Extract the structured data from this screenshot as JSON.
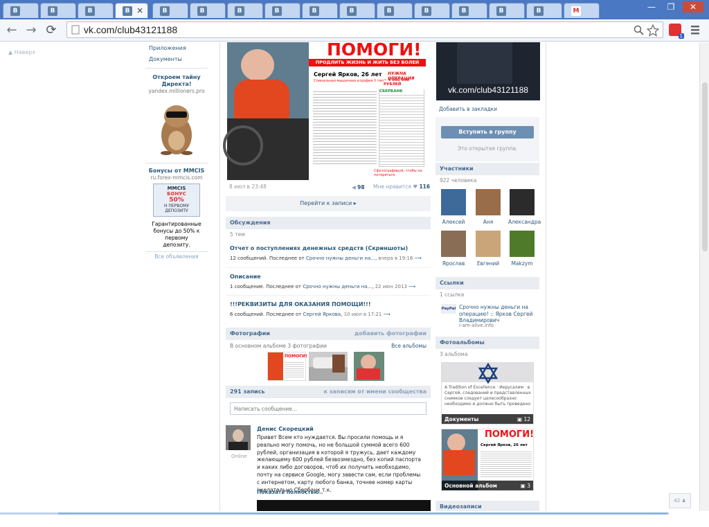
{
  "browser": {
    "tabs": [
      {
        "active": false
      },
      {
        "active": false
      },
      {
        "active": false
      },
      {
        "active": true,
        "close": "×"
      },
      {
        "active": false
      },
      {
        "active": false
      },
      {
        "active": false
      },
      {
        "active": false
      },
      {
        "active": false
      },
      {
        "active": false
      },
      {
        "active": false
      },
      {
        "active": false
      },
      {
        "active": false
      },
      {
        "active": false
      },
      {
        "active": false
      },
      {
        "active": false
      }
    ],
    "url": "vk.com/club43121188",
    "window_buttons": [
      "—",
      "❐",
      "✕"
    ],
    "nav": {
      "back": "←",
      "forward": "→",
      "reload": "⟳"
    },
    "extension_badge": "1"
  },
  "sidebar": {
    "nav_hint": "▲ Наверх",
    "menu": [
      {
        "label": "Приложения"
      },
      {
        "label": "Документы"
      }
    ],
    "ads": [
      {
        "title": "Откроем тайну Директа!",
        "domain": "yandex.millioners.pro"
      },
      {
        "title": "Бонусы от MMCIS",
        "domain": "ru.forex-mmcis.com",
        "banner": "MMCIS",
        "banner_line1": "БОНУС",
        "banner_line2": "50%",
        "banner_line3": "Н ПЕРВОМУ",
        "banner_line4": "ДЕПОЗИТУ",
        "desc": "Гарантированные бонусы до 50% к первому депозиту."
      }
    ],
    "all_ads": "Все объявления"
  },
  "wall": {
    "poster": {
      "headline": "ПОМОГИ!",
      "subheadline": "ПРОДЛИТЬ ЖИЗНЬ И ЖИТЬ БЕЗ БОЛЕЙ",
      "name": "Сергей Ярков, 26 лет",
      "diagnosis": "Спинальная мышечная атрофия II тип",
      "need": "НУЖНА ОПЕРАЦИЯ",
      "amount": "~ 4 000 000 РУБЛЕЙ",
      "bank": "СБЕРБАНК",
      "note": "Сфотографируй, чтобы не потеряться"
    },
    "post_date": "8 июл в 23:48",
    "shares": "98",
    "likes_label": "Мне нравится",
    "likes": "116",
    "goto_post": "Перейти к записи",
    "discussions": {
      "title": "Обсуждения",
      "count": "5 тем",
      "topics": [
        {
          "title": "Отчет о поступлениях денежных средств (Скриншоты)",
          "meta": "12 сообщений. Последнее от",
          "author": "Срочно нужны деньги на...",
          "when": "вчера в 19:16"
        },
        {
          "title": "Описание",
          "meta": "1 сообщение. Последнее от",
          "author": "Срочно нужны деньги на...",
          "when": "22 июн 2013"
        },
        {
          "title": "!!!РЕКВИЗИТЫ ДЛЯ ОКАЗАНИЯ ПОМОЩИ!!!",
          "meta": "6 сообщений. Последнее от",
          "author": "Сергей Яркова",
          "when": "10 июл в 17:21"
        }
      ]
    },
    "photos": {
      "title": "Фотографии",
      "add": "добавить фотографии",
      "desc": "В основном альбоме 3 фотографии",
      "all": "Все альбомы"
    },
    "posts_header": {
      "count": "291 запись",
      "link": "к записям от имени сообщества"
    },
    "compose_placeholder": "Написать сообщение...",
    "post": {
      "author": "Денис Скорецкий",
      "status": "Online",
      "text": "Привет Всем кто нуждается. Вы просили помощь и я реально могу помочь, но не большой суммой всего 600 рублей, организация в которой я тружусь, дает каждому желающему 600 рублей безвозмездно, без копий паспорта и каких либо договоров, чтоб их получить необходимо, почту на сервисе Google, могу завести сам, если проблемы с интернетом, карту любого банка, точнее номер карты (желательно Сбербанк т.к.",
      "more": "Показать полностью.."
    }
  },
  "right": {
    "cover_text": "vk.com/club43121188",
    "bookmark": "Добавить в закладки",
    "join": "Вступить в группу",
    "open_group": "Это открытая группа.",
    "members": {
      "title": "Участники",
      "count": "922 человека",
      "names": [
        "Алексей",
        "Аня",
        "Александра",
        "Ярослав",
        "Евгений",
        "Makzym"
      ]
    },
    "links": {
      "title": "Ссылки",
      "count": "1 ссылка",
      "text": "Срочно нужны деньги на операцию! :: Ярков Сергей Владимирович",
      "domain": "i-am-alive.info",
      "logo": "PayPal"
    },
    "albums": {
      "title": "Фотоальбомы",
      "count": "3 альбома",
      "items": [
        {
          "name": "Документы",
          "count": "12",
          "doc_text": "A Tradition of Excellence · Иерусалим · в Сергей, следований и представленных снимков следует целесообразно необходимо и должно быть проведено"
        },
        {
          "name": "Основной альбом",
          "count": "3",
          "poster": "ПОМОГИ!",
          "poster_sub": "Сергей Ярков, 26 лет"
        }
      ]
    },
    "video": {
      "title": "Видеозаписи"
    }
  },
  "chat_badge": "42"
}
